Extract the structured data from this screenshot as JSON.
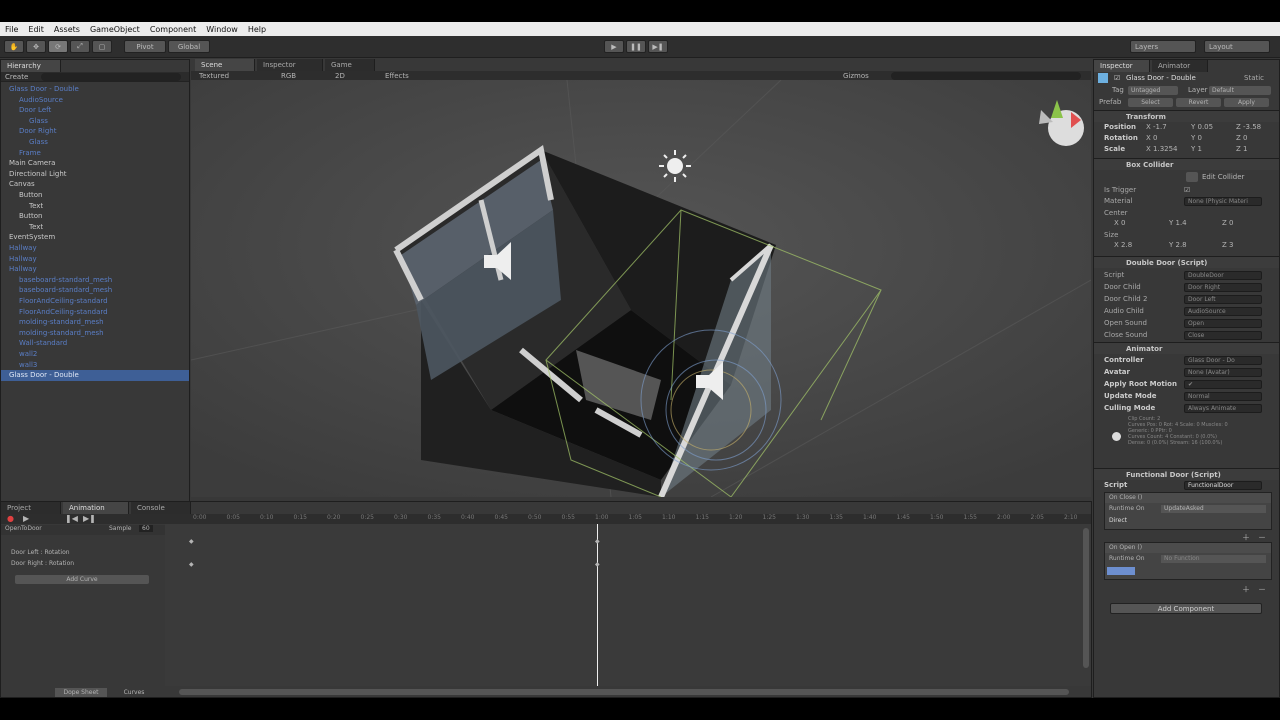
{
  "menu": [
    "File",
    "Edit",
    "Assets",
    "GameObject",
    "Component",
    "Window",
    "Help"
  ],
  "toolbar": {
    "pivot": "Pivot",
    "global": "Global",
    "layers": "Layers",
    "layout": "Layout"
  },
  "hierarchy": {
    "tab": "Hierarchy",
    "create": "Create",
    "items": [
      {
        "label": "Glass Door - Double",
        "indent": 0,
        "color": "blue"
      },
      {
        "label": "AudioSource",
        "indent": 1,
        "color": "blue"
      },
      {
        "label": "Door Left",
        "indent": 1,
        "color": "blue"
      },
      {
        "label": "Glass",
        "indent": 2,
        "color": "blue"
      },
      {
        "label": "Door Right",
        "indent": 1,
        "color": "blue"
      },
      {
        "label": "Glass",
        "indent": 2,
        "color": "blue"
      },
      {
        "label": "Frame",
        "indent": 1,
        "color": "blue"
      },
      {
        "label": "Main Camera",
        "indent": 0,
        "color": "white"
      },
      {
        "label": "Directional Light",
        "indent": 0,
        "color": "white"
      },
      {
        "label": "Canvas",
        "indent": 0,
        "color": "white"
      },
      {
        "label": "Button",
        "indent": 1,
        "color": "white"
      },
      {
        "label": "Text",
        "indent": 2,
        "color": "white"
      },
      {
        "label": "Button",
        "indent": 1,
        "color": "white"
      },
      {
        "label": "Text",
        "indent": 2,
        "color": "white"
      },
      {
        "label": "EventSystem",
        "indent": 0,
        "color": "white"
      },
      {
        "label": "Hallway",
        "indent": 0,
        "color": "blue"
      },
      {
        "label": "Hallway",
        "indent": 0,
        "color": "blue"
      },
      {
        "label": "Hallway",
        "indent": 0,
        "color": "blue"
      },
      {
        "label": "baseboard-standard_mesh",
        "indent": 1,
        "color": "blue"
      },
      {
        "label": "baseboard-standard_mesh",
        "indent": 1,
        "color": "blue"
      },
      {
        "label": "FloorAndCeiling-standard",
        "indent": 1,
        "color": "blue"
      },
      {
        "label": "FloorAndCeiling-standard",
        "indent": 1,
        "color": "blue"
      },
      {
        "label": "molding-standard_mesh",
        "indent": 1,
        "color": "blue"
      },
      {
        "label": "molding-standard_mesh",
        "indent": 1,
        "color": "blue"
      },
      {
        "label": "Wall-standard",
        "indent": 1,
        "color": "blue"
      },
      {
        "label": "wall2",
        "indent": 1,
        "color": "blue"
      },
      {
        "label": "wall3",
        "indent": 1,
        "color": "blue"
      },
      {
        "label": "Glass Door - Double",
        "indent": 0,
        "color": "selected"
      }
    ]
  },
  "scene": {
    "tab_scene": "Scene",
    "tab_inspector": "Inspector",
    "tab_game": "Game",
    "shading": "Textured",
    "rgb": "RGB",
    "mode2d": "2D",
    "effects": "Effects",
    "gizmos": "Gizmos"
  },
  "inspector": {
    "tab": "Inspector",
    "tab_animator": "Animator",
    "object_name": "Glass Door - Double",
    "static": "Static",
    "tag_label": "Tag",
    "tag_value": "Untagged",
    "layer_label": "Layer",
    "layer_value": "Default",
    "prefab_label": "Prefab",
    "prefab_select": "Select",
    "prefab_revert": "Revert",
    "prefab_apply": "Apply",
    "transform": {
      "title": "Transform",
      "position_label": "Position",
      "position": [
        "X -1.7",
        "Y 0.05",
        "Z -3.58"
      ],
      "rotation_label": "Rotation",
      "rotation": [
        "X 0",
        "Y 0",
        "Z 0"
      ],
      "scale_label": "Scale",
      "scale": [
        "X 1.3254",
        "Y 1",
        "Z 1"
      ]
    },
    "box_collider": {
      "title": "Box Collider",
      "edit": "Edit Collider",
      "is_trigger": "Is Trigger",
      "material": "Material",
      "material_value": "None (Physic Materi",
      "center": "Center",
      "center_values": [
        "X 0",
        "Y 1.4",
        "Z 0"
      ],
      "size": "Size",
      "size_values": [
        "X 2.8",
        "Y 2.8",
        "Z 3"
      ]
    },
    "double_door": {
      "title": "Double Door (Script)",
      "rows": [
        {
          "label": "Script",
          "value": "DoubleDoor"
        },
        {
          "label": "Door Child",
          "value": "Door Right"
        },
        {
          "label": "Door Child 2",
          "value": "Door Left"
        },
        {
          "label": "Audio Child",
          "value": "AudioSource"
        },
        {
          "label": "Open Sound",
          "value": "Open"
        },
        {
          "label": "Close Sound",
          "value": "Close"
        }
      ]
    },
    "animator": {
      "title": "Animator",
      "rows": [
        {
          "label": "Controller",
          "value": "Glass Door - Do"
        },
        {
          "label": "Avatar",
          "value": "None (Avatar)"
        },
        {
          "label": "Apply Root Motion",
          "value": "✔"
        },
        {
          "label": "Update Mode",
          "value": "Normal"
        },
        {
          "label": "Culling Mode",
          "value": "Always Animate"
        }
      ],
      "info": [
        "Clip Count: 2",
        "Curves Pos: 0 Rot: 4 Scale: 0 Muscles: 0",
        "Generic: 0 PPtr: 0",
        "Curves Count: 4 Constant: 0 (0.0%)",
        "Dense: 0 (0.0%) Stream: 16 (100.0%)"
      ]
    },
    "functional_door": {
      "title": "Functional Door (Script)",
      "script_label": "Script",
      "script_value": "FunctionalDoor",
      "on_close": "On Close ()",
      "runtime": "Runtime On",
      "func": "UpdateAsked",
      "target": "Direct",
      "on_open": "On Open ()",
      "runtime2": "Runtime On",
      "no_function": "No Function"
    },
    "add_component": "Add Component"
  },
  "bottom": {
    "tab_project": "Project",
    "tab_animation": "Animation",
    "tab_console": "Console",
    "clip": "OpenToDoor",
    "samples_label": "Sample",
    "samples": "60",
    "curves": [
      "Door Left : Rotation",
      "Door Right : Rotation"
    ],
    "add_curve": "Add Curve",
    "dope_sheet": "Dope Sheet",
    "curves_tab": "Curves",
    "ticks": [
      "0:00",
      "0:05",
      "0:10",
      "0:15",
      "0:20",
      "0:25",
      "0:30",
      "0:35",
      "0:40",
      "0:45",
      "0:50",
      "0:55",
      "1:00",
      "1:05",
      "1:10",
      "1:15",
      "1:20",
      "1:25",
      "1:30",
      "1:35",
      "1:40",
      "1:45",
      "1:50",
      "1:55",
      "2:00",
      "2:05",
      "2:10",
      "2:15"
    ]
  },
  "colors": {
    "accent": "#3e5f96",
    "blue_text": "#5a7ec6"
  }
}
